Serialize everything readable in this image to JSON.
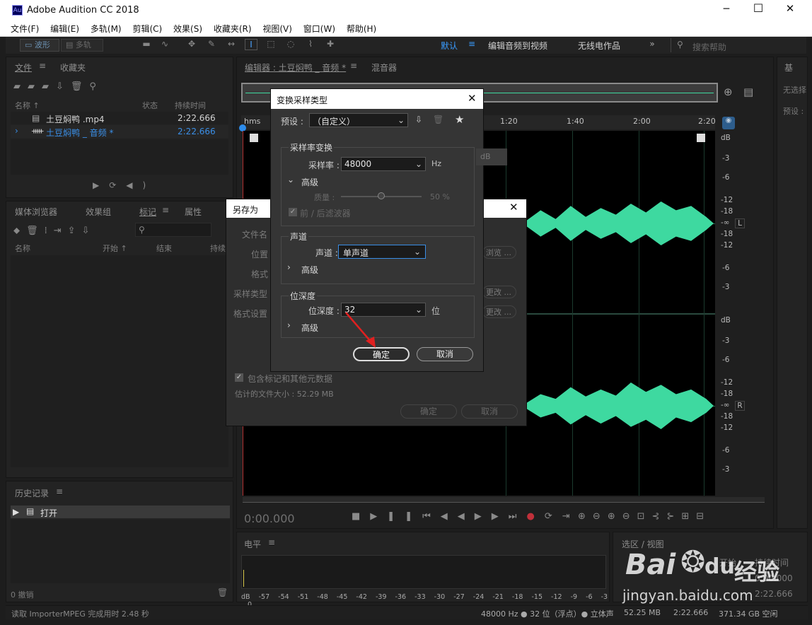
{
  "app": {
    "title": "Adobe Audition CC 2018",
    "logo": "Au"
  },
  "window_controls": [
    "minimize-icon",
    "maximize-icon",
    "close-icon"
  ],
  "menu": [
    "文件(F)",
    "编辑(E)",
    "多轨(M)",
    "剪辑(C)",
    "效果(S)",
    "收藏夹(R)",
    "视图(V)",
    "窗口(W)",
    "帮助(H)"
  ],
  "toolbar": {
    "waveform": "波形",
    "multitrack": "多轨",
    "workspaces": [
      "默认",
      "编辑音频到视频",
      "无线电作品"
    ],
    "workspace_menu": "≡",
    "search_placeholder": "搜索帮助"
  },
  "files_panel": {
    "tabs": [
      "文件",
      "收藏夹"
    ],
    "columns": [
      "名称 ↑",
      "状态",
      "持续时间"
    ],
    "rows": [
      {
        "name": "土豆焖鸭 .mp4",
        "duration": "2:22.666"
      },
      {
        "name": "土豆焖鸭 _ 音频 *",
        "duration": "2:22.666"
      }
    ]
  },
  "markers_panel": {
    "tabs": [
      "媒体浏览器",
      "效果组",
      "标记",
      "属性"
    ],
    "columns": [
      "名称",
      "开始 ↑",
      "结束",
      "持续"
    ]
  },
  "history_panel": {
    "title": "历史记录",
    "item": "打开",
    "undo_count": "0 撤销"
  },
  "editor": {
    "tabs": [
      "编辑器 : 土豆焖鸭 _ 音频 *",
      "混音器"
    ],
    "ruler_unit": "hms",
    "ruler": [
      "1:20",
      "1:40",
      "2:00",
      "2:20"
    ],
    "db_scale_top": [
      "dB",
      "-3",
      "-6",
      "-12",
      "-18",
      "-∞",
      "-18",
      "-12",
      "-6",
      "-3"
    ],
    "db_scale_bottom": [
      "dB",
      "-3",
      "-6",
      "-12",
      "-18",
      "-∞",
      "-18",
      "-12",
      "-6",
      "-3"
    ],
    "channel_top": "L",
    "channel_bottom": "R",
    "time": "0:00.000"
  },
  "levels_panel": {
    "title": "电平",
    "scale": [
      "dB",
      "-57",
      "-54",
      "-51",
      "-48",
      "-45",
      "-42",
      "-39",
      "-36",
      "-33",
      "-30",
      "-27",
      "-24",
      "-21",
      "-18",
      "-15",
      "-12",
      "-9",
      "-6",
      "-3",
      "0"
    ]
  },
  "selection_panel": {
    "title": "选区 / 视图",
    "start": "开始",
    "duration": "持续时间",
    "value1": "0:00.000",
    "value2": "2:22.666"
  },
  "right_panel": {
    "title": "基",
    "label1": "无选择",
    "label2": "预设 :"
  },
  "save_as_dialog": {
    "title": "另存为",
    "labels": [
      "文件名",
      "位置",
      "格式",
      "采样类型",
      "格式设置"
    ],
    "browse": "浏览 ...",
    "change1": "更改 ...",
    "change2": "更改 ...",
    "include_markers": "包含标记和其他元数据",
    "file_size": "估计的文件大小 : 52.29 MB",
    "ok": "确定",
    "cancel": "取消"
  },
  "convert_dialog": {
    "title": "变换采样类型",
    "preset_label": "预设 :",
    "preset_value": "（自定义）",
    "sample_rate_section": "采样率变换",
    "sample_rate_label": "采样率 :",
    "sample_rate_value": "48000",
    "sample_rate_unit": "Hz",
    "advanced": "高级",
    "quality_label": "质量 :",
    "quality_value": "50 %",
    "quality_level": 0.5,
    "prefilter": "前 / 后滤波器",
    "db_hint": "dB",
    "channels_section": "声道",
    "channels_label": "声道 :",
    "channels_value": "单声道",
    "bitdepth_section": "位深度",
    "bitdepth_label": "位深度 :",
    "bitdepth_value": "32",
    "bitdepth_unit": "位",
    "ok": "确定",
    "cancel": "取消"
  },
  "status": {
    "left": "读取 ImporterMPEG 完成用时 2.48 秒",
    "format": "48000 Hz ● 32 位（浮点）● 立体声",
    "size": "52.25 MB",
    "duration": "2:22.666",
    "free": "371.34 GB 空闲"
  },
  "watermark": {
    "brand": "Bai",
    "brand2": "du",
    "suffix": "经验",
    "url": "jingyan.baidu.com"
  },
  "colors": {
    "accent": "#2d8ceb",
    "waveform": "#3ed9a0",
    "selected_text": "#3a8ee6"
  }
}
